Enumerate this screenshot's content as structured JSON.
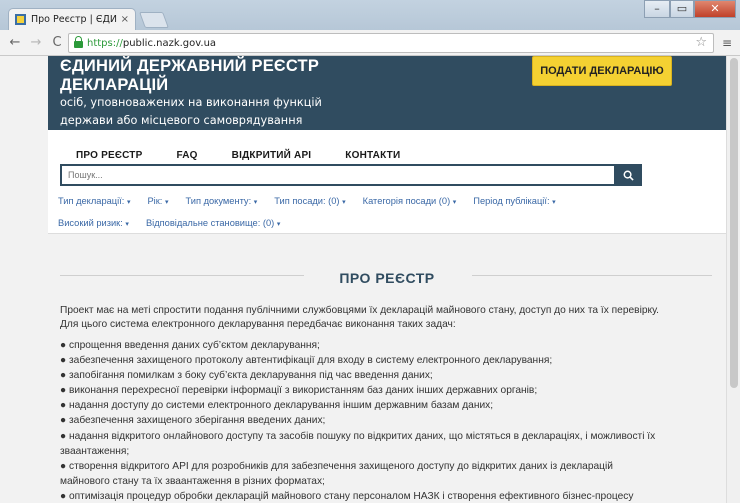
{
  "browser": {
    "tab_title": "Про Реєстр | ЄДИНИЙ Д",
    "tab_close": "×",
    "url_scheme": "https://",
    "url_host": "public.nazk.gov.ua",
    "back_glyph": "←",
    "forward_glyph": "→",
    "reload_glyph": "C",
    "star_glyph": "☆",
    "menu_glyph": "≡",
    "min_glyph": "–",
    "max_glyph": "▭",
    "close_glyph": "✕"
  },
  "header": {
    "title": "ЄДИНИЙ ДЕРЖАВНИЙ РЕЄСТР ДЕКЛАРАЦІЙ",
    "subtitle": "осіб, уповноважених на виконання функцій держави або місцевого самоврядування",
    "submit_label": "ПОДАТИ ДЕКЛАРАЦІЮ"
  },
  "nav": {
    "about": "ПРО РЕЄСТР",
    "faq": "FAQ",
    "api": "ВІДКРИТИЙ API",
    "contacts": "КОНТАКТИ"
  },
  "search": {
    "placeholder": "Пошук..."
  },
  "filters": {
    "declaration_type": "Тип декларації:",
    "year": "Рік:",
    "document_type": "Тип документу:",
    "position_type": "Тип посади: (0)",
    "position_category": "Категорія посади (0)",
    "publication_period": "Період публікації:",
    "high_risk": "Високий ризик:",
    "responsible_position": "Відповідальне становище: (0)",
    "caret": "▾"
  },
  "about": {
    "title": "ПРО РЕЄСТР",
    "intro_1": "Проект має на меті спростити подання публічними службовцями їх декларацій майнового стану, доступ до них та їх перевірку.",
    "intro_2": "Для цього система електронного декларування передбачає виконання таких задач:",
    "items": [
      "● спрощення введення даних суб’єктом декларування;",
      "● забезпечення захищеного протоколу автентифікації для входу в систему електронного декларування;",
      "● запобігання помилкам з боку суб’єкта декларування під час введення даних;",
      "● виконання перехресної перевірки інформації з використанням баз даних інших державних органів;",
      "● надання доступу до системи електронного декларування іншим державним базам даних;",
      "● забезпечення захищеного зберігання введених даних;",
      "● надання відкритого онлайнового доступу та засобів пошуку по відкритих даних, що містяться в деклараціях, і можливості їх",
      "зваантаження;",
      "● створення відкритого API для розробників для забезпечення захищеного доступу до відкритих даних із декларацій",
      "майнового стану та їх зваантаження в різних форматах;",
      "● оптимізація процедур обробки декларацій майнового стану персоналом НАЗК і створення ефективного бізнес-процесу"
    ]
  },
  "colors": {
    "header_bg": "#304c60",
    "accent_yellow": "#f4d132",
    "link_blue": "#3a68a6"
  }
}
